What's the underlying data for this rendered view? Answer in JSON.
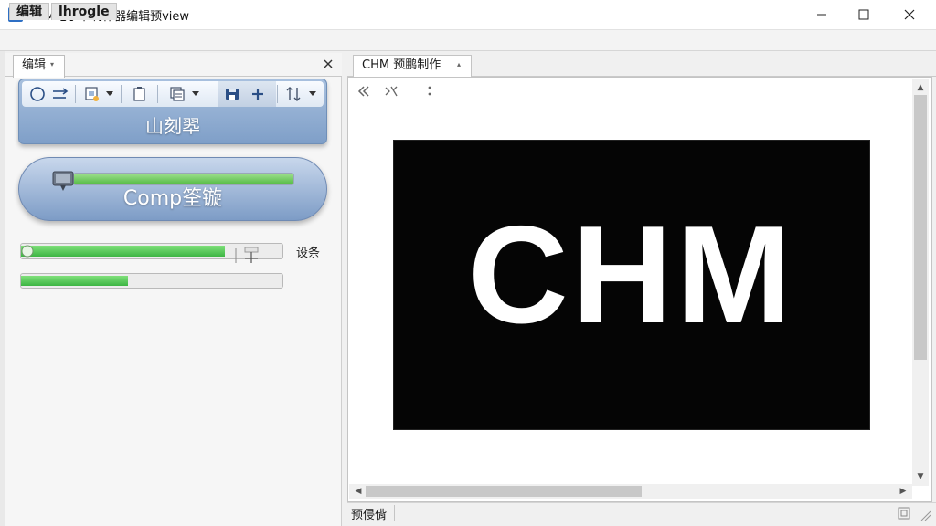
{
  "window": {
    "title": "CHM电子书制作器编辑预view",
    "icons": {
      "app": "chm-app-icon",
      "minimize": "minimize-icon",
      "maximize": "maximize-icon",
      "close": "close-icon"
    }
  },
  "menubar": {
    "items": [
      {
        "label": "编辑"
      },
      {
        "label": "lhrogle"
      }
    ]
  },
  "left_panel": {
    "tab_label": "编辑",
    "toolbar": {
      "icons": [
        "circle-icon",
        "arrows-right-icon",
        "image-edit-icon",
        "dropdown-arrow-icon",
        "document-icon",
        "copy-pages-icon",
        "dropdown-arrow-icon",
        "save-disk-icon",
        "plus-icon",
        "sort-icon",
        "dropdown-arrow-icon"
      ],
      "caption": "山刻翆"
    },
    "comp": {
      "label": "Comp筌镟",
      "progress": 1.0
    },
    "progress1": {
      "value": 0.78,
      "label": "设条"
    },
    "progress2": {
      "value": 0.41
    }
  },
  "right_panel": {
    "tab_label": "CHM 预鹏制作",
    "viewer_icons": [
      "double-chevron-left-icon",
      "split-arrows-icon",
      "vertical-dots-icon"
    ],
    "preview_text": "CHM",
    "scroll": {
      "vertical_pos": 0.0,
      "horizontal_pos": 0.0
    },
    "status_text": "预侵偝"
  },
  "colors": {
    "accent_blue": "#7f9fc8",
    "progress_green": "#3db544",
    "preview_bg": "#050505"
  }
}
